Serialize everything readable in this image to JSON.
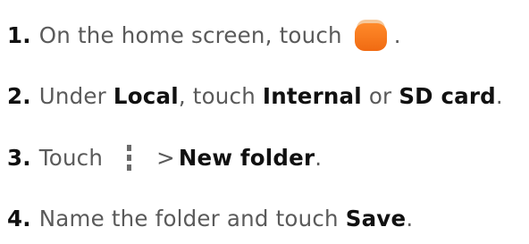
{
  "steps": [
    {
      "number": "1.",
      "text_before": "On the home screen, touch",
      "icon": "file-manager-folder-icon",
      "text_after": "."
    },
    {
      "number": "2.",
      "text_1": "Under ",
      "bold_1": "Local",
      "text_2": ", touch ",
      "bold_2": "Internal",
      "text_3": " or ",
      "bold_3": "SD card",
      "text_4": "."
    },
    {
      "number": "3.",
      "text_before": "Touch",
      "icon": "overflow-menu-icon",
      "separator": ">",
      "bold": "New folder",
      "text_after": "."
    },
    {
      "number": "4.",
      "text_before": "Name the folder and touch ",
      "bold": "Save",
      "text_after": "."
    }
  ],
  "colors": {
    "step_text": "#5a5a5a",
    "emphasis": "#111111",
    "folder_icon": "#f06a12",
    "menu_icon": "#6b6b6b"
  }
}
